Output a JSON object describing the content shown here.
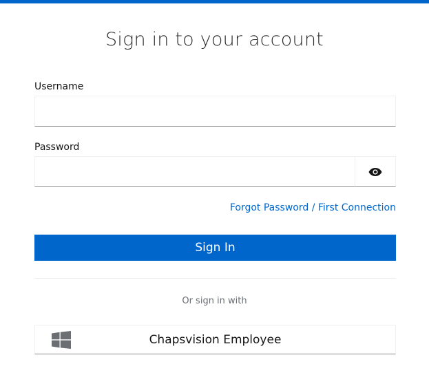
{
  "colors": {
    "accent": "#0066cc",
    "text": "#151515",
    "muted": "#6a6e73",
    "icon": "#6b6f73"
  },
  "page": {
    "title": "Sign in to your account"
  },
  "form": {
    "username_label": "Username",
    "username_value": "",
    "password_label": "Password",
    "password_value": "",
    "show_password_icon": "eye-icon",
    "forgot_link": "Forgot Password / First Connection",
    "submit_label": "Sign In"
  },
  "social": {
    "or_text": "Or sign in with",
    "providers": [
      {
        "icon": "windows-icon",
        "label": "Chapsvision Employee"
      }
    ]
  }
}
